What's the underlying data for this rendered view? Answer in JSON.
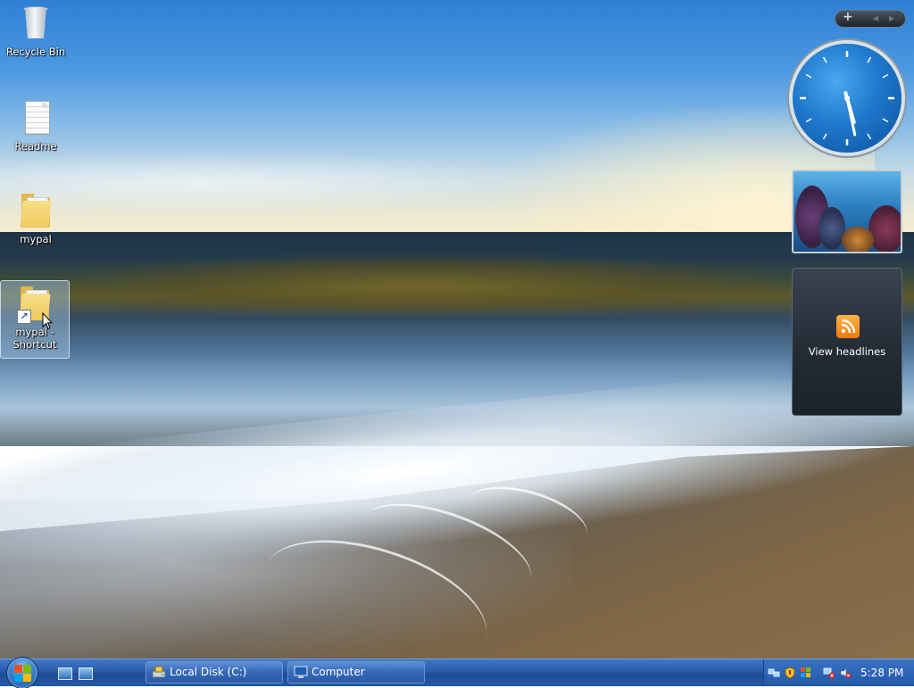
{
  "desktop": {
    "icons": [
      {
        "label": "Recycle Bin",
        "icon": "recycle-bin-icon"
      },
      {
        "label": "Readme",
        "icon": "document-icon"
      },
      {
        "label": "mypal",
        "icon": "folder-icon"
      },
      {
        "label": "mypal - Shortcut",
        "icon": "folder-shortcut-icon",
        "selected": true
      }
    ]
  },
  "sidebar": {
    "controls": {
      "add": "+",
      "prev": "◂",
      "next": "▸"
    },
    "clock_gadget": {
      "hour": 5,
      "minute": 28
    },
    "feed_gadget": {
      "label": "View headlines",
      "icon": "rss-icon"
    }
  },
  "taskbar": {
    "start": {
      "icon": "windows-start-orb-icon"
    },
    "quick_launch": [
      {
        "icon": "show-desktop-icon"
      },
      {
        "icon": "switch-windows-icon"
      }
    ],
    "buttons": [
      {
        "label": "Local Disk (C:)",
        "icon": "local-disk-icon"
      },
      {
        "label": "Computer",
        "icon": "computer-icon"
      }
    ],
    "tray": {
      "icons": [
        "network-icon",
        "security-shield-icon",
        "windows-update-icon",
        "network-disconnected-icon",
        "volume-muted-icon"
      ],
      "time": "5:28 PM"
    }
  },
  "colors": {
    "taskbar": "#2a5aa8",
    "clock_face": "#1f78cc",
    "rss": "#f0780f",
    "selection": "#aacdeb"
  }
}
